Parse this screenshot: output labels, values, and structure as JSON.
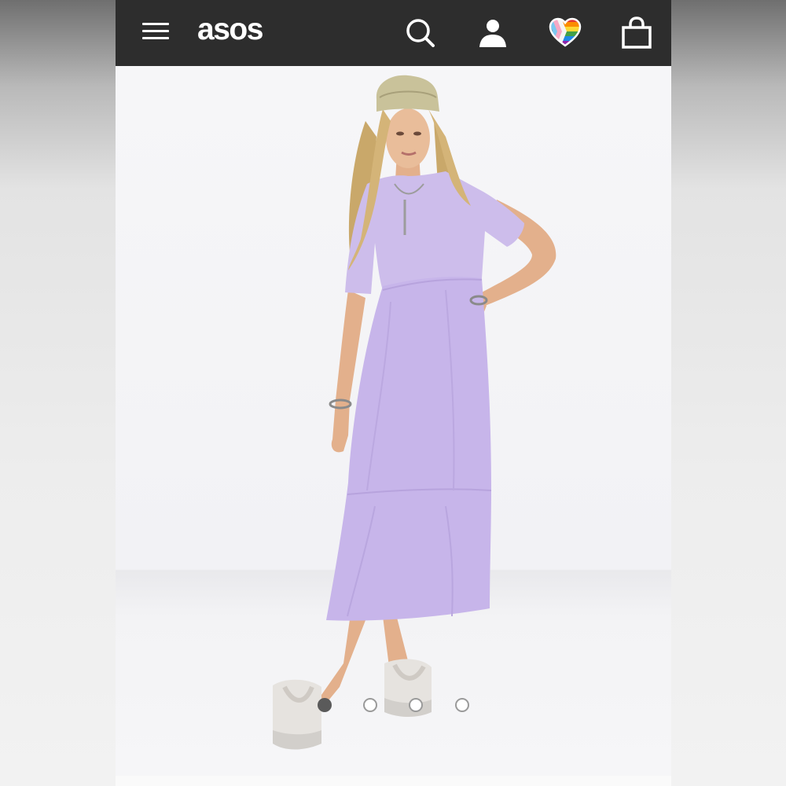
{
  "header": {
    "logo_text": "asos",
    "icons": [
      "menu-icon",
      "search-icon",
      "account-icon",
      "rainbow-heart-icon",
      "shopping-bag-icon"
    ]
  },
  "colors": {
    "header_bg": "#2d2d2d",
    "dress": "#c9b8ea",
    "carousel_active": "#5a5a5a",
    "carousel_inactive": "#ffffff"
  },
  "product_image": {
    "subject": "product-photo",
    "carousel": {
      "total_slides": 4,
      "active_index": 0
    }
  }
}
